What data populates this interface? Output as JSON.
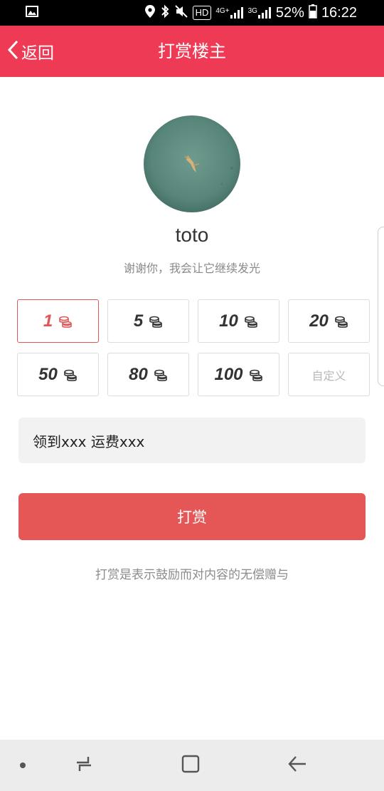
{
  "status_bar": {
    "battery": "52%",
    "time": "16:22",
    "hd": "HD",
    "net_1": "4G+",
    "net_2": "3G"
  },
  "header": {
    "back_label": "返回",
    "title": "打赏楼主"
  },
  "profile": {
    "username": "toto",
    "subtitle": "谢谢你，我会让它继续发光"
  },
  "amounts": [
    {
      "value": "1",
      "selected": true
    },
    {
      "value": "5"
    },
    {
      "value": "10"
    },
    {
      "value": "20"
    },
    {
      "value": "50"
    },
    {
      "value": "80"
    },
    {
      "value": "100"
    }
  ],
  "custom_label": "自定义",
  "message_value": "领到xxx 运费xxx",
  "submit_label": "打赏",
  "disclaimer": "打赏是表示鼓励而对内容的无偿赠与",
  "colors": {
    "header": "#ee3a54",
    "accent": "#e25556",
    "button": "#e55657"
  }
}
